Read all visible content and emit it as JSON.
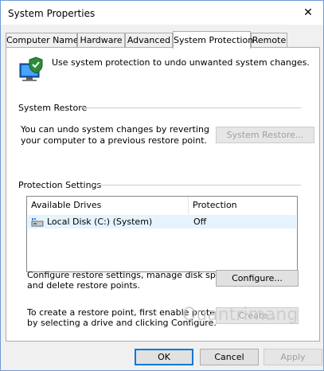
{
  "window": {
    "title": "System Properties",
    "close_glyph": "✕"
  },
  "tabs": [
    {
      "label": "Computer Name"
    },
    {
      "label": "Hardware"
    },
    {
      "label": "Advanced"
    },
    {
      "label": "System Protection",
      "active": true
    },
    {
      "label": "Remote"
    }
  ],
  "intro": {
    "icon": "system-protection-shield-icon",
    "text": "Use system protection to undo unwanted system changes."
  },
  "system_restore": {
    "title": "System Restore",
    "text_line1": "You can undo system changes by reverting",
    "text_line2": "your computer to a previous restore point.",
    "button": "System Restore..."
  },
  "protection_settings": {
    "title": "Protection Settings",
    "columns": [
      "Available Drives",
      "Protection"
    ],
    "rows": [
      {
        "drive": "Local Disk (C:) (System)",
        "protection": "Off",
        "icon": "drive-icon"
      }
    ],
    "configure_text_line1": "Configure restore settings, manage disk space,",
    "configure_text_line2": "and delete restore points.",
    "configure_button": "Configure...",
    "create_text_line1": "To create a restore point, first enable protection",
    "create_text_line2": "by selecting a drive and clicking Configure.",
    "create_button": "Create..."
  },
  "buttons": {
    "ok": "OK",
    "cancel": "Cancel",
    "apply": "Apply"
  },
  "watermark": "Quantrimang",
  "colors": {
    "accent": "#0078d7",
    "selection": "#e5f3ff",
    "disabled_text": "#a0a0a0"
  }
}
